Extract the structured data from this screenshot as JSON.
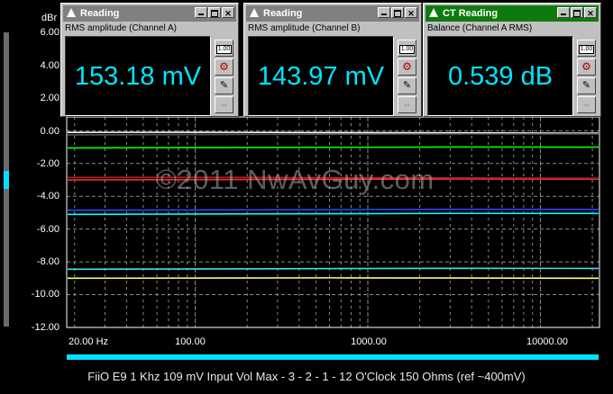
{
  "graph": {
    "y_axis_unit": "dBr",
    "y_ticks": [
      "6.00",
      "4.00",
      "2.00",
      "0.00",
      "-2.00",
      "-4.00",
      "-6.00",
      "-8.00",
      "-10.00",
      "-12.00"
    ],
    "x_ticks": [
      "20.00 Hz",
      "100.00",
      "1000.00",
      "10000.00"
    ],
    "watermark": "©2011 NwAvGuy.com",
    "caption": "FiiO E9 1 Khz 109 mV Input Vol Max - 3 - 2 - 1 - 12 O'Clock 150 Ohms (ref ~400mV)",
    "colors": {
      "grid": "#8a8a8a",
      "axis": "#ffffff",
      "accent": "#00e5ff"
    },
    "traces": [
      {
        "color": "#ffffff",
        "start": -0.1,
        "end": -0.15
      },
      {
        "color": "#555555",
        "start": -0.25,
        "end": -0.2
      },
      {
        "color": "#00ff00",
        "start": -1.05,
        "end": -1.0
      },
      {
        "color": "#ff3030",
        "start": -3.0,
        "end": -2.95
      },
      {
        "color": "#aa2222",
        "start": -2.85,
        "end": -2.9
      },
      {
        "color": "#3344ff",
        "start": -4.85,
        "end": -4.8
      },
      {
        "color": "#00ffff",
        "start": -5.1,
        "end": -5.05
      },
      {
        "color": "#40e0e8",
        "start": -8.45,
        "end": -8.4
      },
      {
        "color": "#ffff66",
        "start": -9.0,
        "end": -9.0
      }
    ]
  },
  "windows": [
    {
      "title": "Reading",
      "label": "RMS amplitude (Channel A)",
      "value": "153.18 mV",
      "active": false
    },
    {
      "title": "Reading",
      "label": "RMS amplitude (Channel B)",
      "value": "143.97 mV",
      "active": false
    },
    {
      "title": "CT Reading",
      "label": "Balance (Channel A RMS)",
      "value": "0.539 dB",
      "active": true
    }
  ],
  "window_controls": {
    "minimize": "_",
    "maximize": "□",
    "close": "✕"
  },
  "tool_buttons": {
    "format": "1.00"
  }
}
